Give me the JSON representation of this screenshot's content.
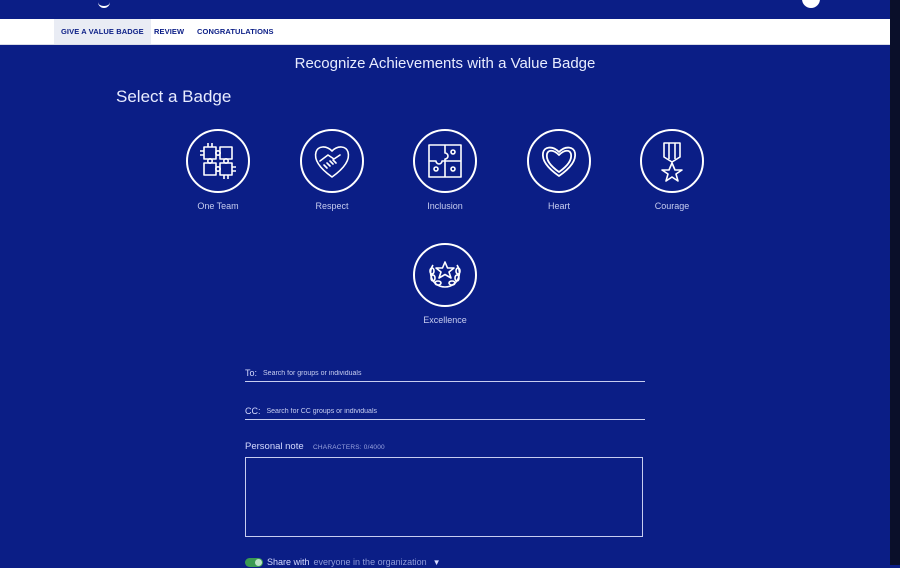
{
  "nav": {
    "tabs": [
      {
        "label": "GIVE A VALUE BADGE",
        "active": true
      },
      {
        "label": "REVIEW",
        "active": false
      },
      {
        "label": "CONGRATULATIONS",
        "active": false
      }
    ]
  },
  "page": {
    "title": "Recognize Achievements with a Value Badge",
    "section_title": "Select a Badge"
  },
  "badges": [
    {
      "label": "One Team",
      "icon": "puzzle-hands-icon"
    },
    {
      "label": "Respect",
      "icon": "handshake-heart-icon"
    },
    {
      "label": "Inclusion",
      "icon": "puzzle-icon"
    },
    {
      "label": "Heart",
      "icon": "heart-icon"
    },
    {
      "label": "Courage",
      "icon": "medal-star-icon"
    },
    {
      "label": "Excellence",
      "icon": "laurel-star-icon"
    }
  ],
  "form": {
    "to": {
      "label": "To:",
      "placeholder": "Search for groups or individuals"
    },
    "cc": {
      "label": "CC:",
      "placeholder": "Search for CC groups or individuals"
    },
    "note": {
      "label": "Personal note",
      "counter": "CHARACTERS: 0/4000"
    },
    "share": {
      "label": "Share with",
      "value": "everyone in the organization"
    }
  },
  "colors": {
    "background": "#0b1e86",
    "nav_bg": "#ffffff",
    "nav_text": "#0b1e86",
    "toggle_on": "#3a9a52"
  }
}
